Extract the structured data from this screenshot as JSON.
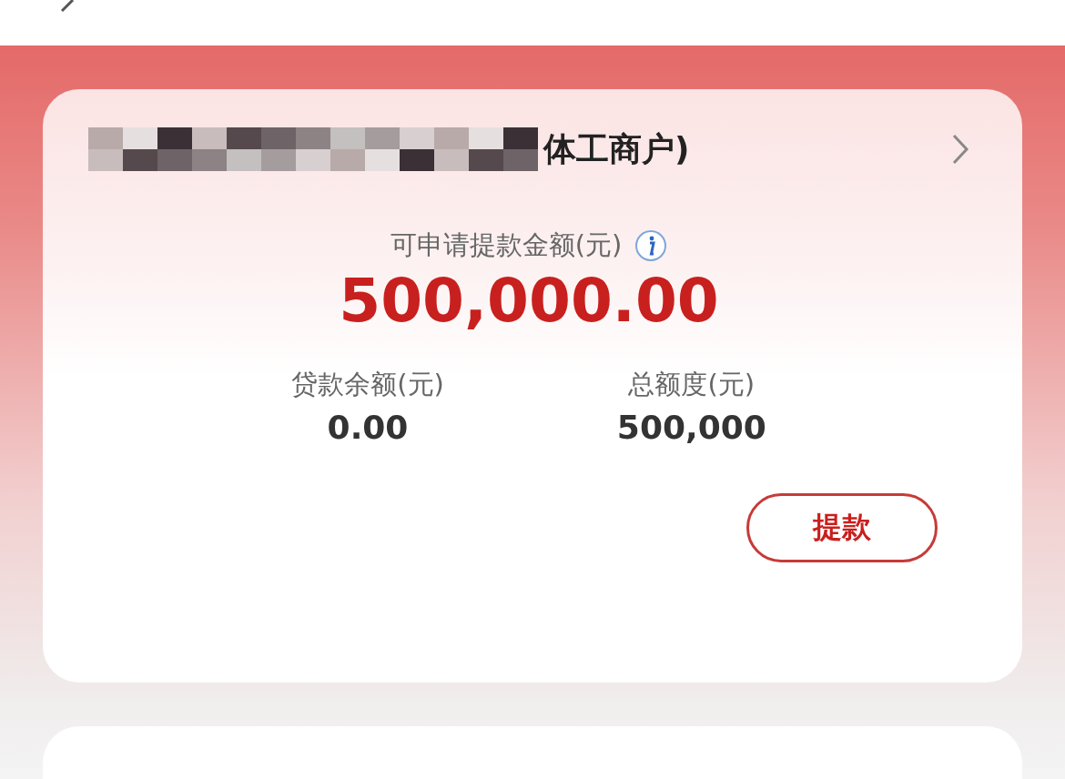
{
  "account": {
    "name_visible": "体工商户)"
  },
  "available": {
    "label": "可申请提款金额(元)",
    "amount": "500,000.00"
  },
  "stats": [
    {
      "label": "贷款余额(元)",
      "value": "0.00"
    },
    {
      "label": "总额度(元)",
      "value": "500,000"
    }
  ],
  "action_button": "提款"
}
